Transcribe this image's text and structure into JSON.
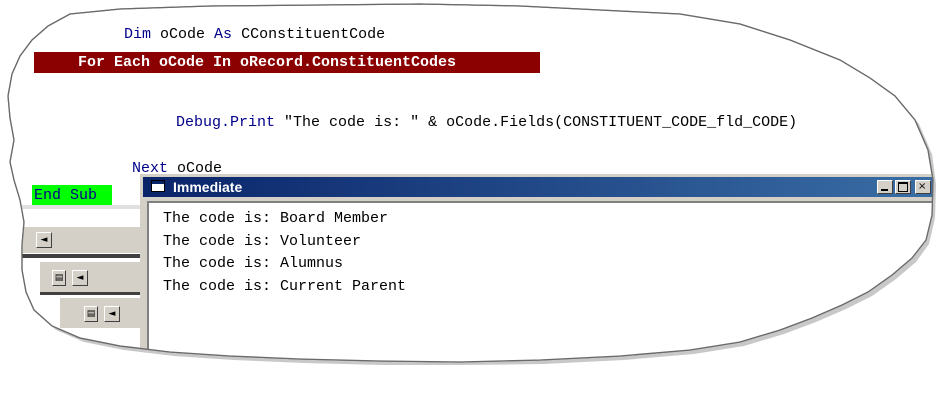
{
  "code_editor": {
    "line_dim": {
      "kw1": "Dim",
      "name": " oCode ",
      "kw2": "As",
      "type": " CConstituentCode"
    },
    "line_for_each": "For Each oCode In oRecord.ConstituentCodes",
    "line_debug": "Debug.Print \"The code is: \" & oCode.Fields(CONSTITUENT_CODE_fld_CODE)",
    "line_next": {
      "kw": "Next",
      "rest": " oCode"
    },
    "line_end_sub": "End Sub",
    "colors": {
      "keyword": "#00008b",
      "breakpoint_bg": "#8b0000",
      "current_bg": "#00ff00"
    }
  },
  "immediate_window": {
    "title": "Immediate",
    "lines": [
      "The code is: Board Member",
      "The code is: Volunteer",
      "The code is: Alumnus",
      "The code is: Current Parent"
    ],
    "titlebar_colors": [
      "#0a246a",
      "#3a6ea5"
    ]
  },
  "icons": {
    "scroll_left": "◄",
    "window_icon": "immediate-window-icon",
    "minimize": "minimize-icon",
    "maximize": "maximize-icon"
  }
}
